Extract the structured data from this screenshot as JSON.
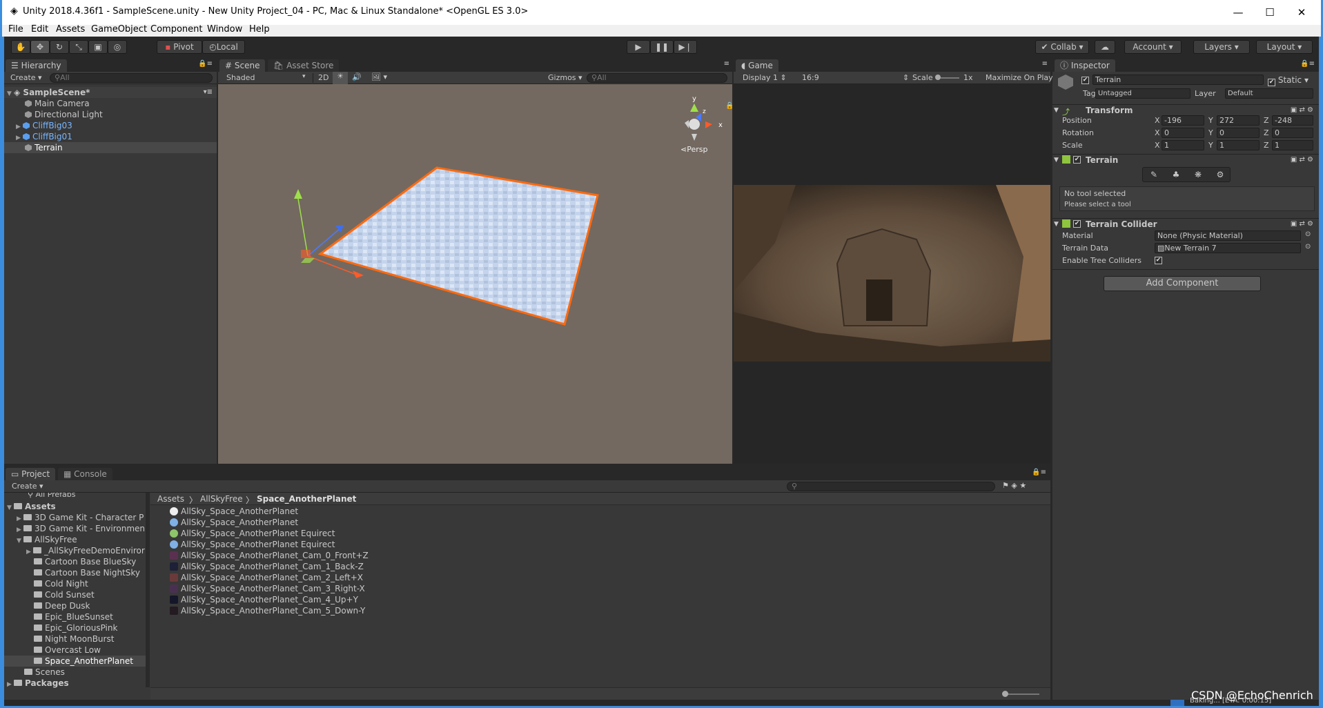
{
  "window": {
    "title": "Unity 2018.4.36f1 - SampleScene.unity - New Unity Project_04 - PC, Mac & Linux Standalone* <OpenGL ES 3.0>",
    "min": "—",
    "max": "☐",
    "close": "✕"
  },
  "menu": [
    "File",
    "Edit",
    "Assets",
    "GameObject",
    "Component",
    "Window",
    "Help"
  ],
  "toolbar": {
    "pivot": "Pivot",
    "local": "Local",
    "collab": "Collab",
    "account": "Account",
    "layers": "Layers",
    "layout": "Layout"
  },
  "hierarchy": {
    "tab": "Hierarchy",
    "create": "Create",
    "search": "All",
    "scene": "SampleScene*",
    "items": [
      {
        "label": "Main Camera"
      },
      {
        "label": "Directional Light"
      },
      {
        "label": "CliffBig03"
      },
      {
        "label": "CliffBig01"
      },
      {
        "label": "Terrain"
      }
    ]
  },
  "scene": {
    "tab": "Scene",
    "asset_store": "Asset Store",
    "shading": "Shaded",
    "mode2d": "2D",
    "gizmos": "Gizmos",
    "search": "All",
    "persp": "Persp",
    "axis_y": "y",
    "axis_x": "x",
    "axis_z": "z"
  },
  "game": {
    "tab": "Game",
    "display": "Display 1",
    "aspect": "16:9",
    "scale_label": "Scale",
    "scale_value": "1x",
    "maximize": "Maximize On Play"
  },
  "inspector": {
    "tab": "Inspector",
    "object_name": "Terrain",
    "static_label": "Static",
    "tag_label": "Tag",
    "tag_value": "Untagged",
    "layer_label": "Layer",
    "layer_value": "Default",
    "transform": {
      "title": "Transform",
      "position": {
        "label": "Position",
        "x": "-196",
        "y": "272",
        "z": "-248"
      },
      "rotation": {
        "label": "Rotation",
        "x": "0",
        "y": "0",
        "z": "0"
      },
      "scale": {
        "label": "Scale",
        "x": "1",
        "y": "1",
        "z": "1"
      },
      "x": "X",
      "y": "Y",
      "z": "Z"
    },
    "terrain": {
      "title": "Terrain",
      "no_tool": "No tool selected",
      "hint": "Please select a tool"
    },
    "collider": {
      "title": "Terrain Collider",
      "material_label": "Material",
      "material_value": "None (Physic Material)",
      "data_label": "Terrain Data",
      "data_value": "New Terrain 7",
      "trees_label": "Enable Tree Colliders"
    },
    "add_component": "Add Component"
  },
  "project": {
    "tab": "Project",
    "console": "Console",
    "create": "Create",
    "tree": [
      {
        "label": "All Prefabs"
      },
      {
        "label": "Assets"
      },
      {
        "label": "3D Game Kit - Character P"
      },
      {
        "label": "3D Game Kit - Environmen"
      },
      {
        "label": "AllSkyFree"
      },
      {
        "label": "_AllSkyFreeDemoEnviror"
      },
      {
        "label": "Cartoon Base BlueSky"
      },
      {
        "label": "Cartoon Base NightSky"
      },
      {
        "label": "Cold Night"
      },
      {
        "label": "Cold Sunset"
      },
      {
        "label": "Deep Dusk"
      },
      {
        "label": "Epic_BlueSunset"
      },
      {
        "label": "Epic_GloriousPink"
      },
      {
        "label": "Night MoonBurst"
      },
      {
        "label": "Overcast Low"
      },
      {
        "label": "Space_AnotherPlanet"
      },
      {
        "label": "Scenes"
      },
      {
        "label": "Packages"
      }
    ],
    "breadcrumb": [
      "Assets",
      "AllSkyFree",
      "Space_AnotherPlanet"
    ],
    "files": [
      "AllSky_Space_AnotherPlanet",
      "AllSky_Space_AnotherPlanet",
      "AllSky_Space_AnotherPlanet Equirect",
      "AllSky_Space_AnotherPlanet Equirect",
      "AllSky_Space_AnotherPlanet_Cam_0_Front+Z",
      "AllSky_Space_AnotherPlanet_Cam_1_Back-Z",
      "AllSky_Space_AnotherPlanet_Cam_2_Left+X",
      "AllSky_Space_AnotherPlanet_Cam_3_Right-X",
      "AllSky_Space_AnotherPlanet_Cam_4_Up+Y",
      "AllSky_Space_AnotherPlanet_Cam_5_Down-Y"
    ]
  },
  "status": {
    "baking": "Baking... [ETA: 0:00:15]",
    "watermark": "CSDN @EchoChenrich"
  },
  "colors": {
    "selection_orange": "#ff6a10",
    "accent_blue": "#3a8ddf",
    "link_blue": "#7ab6ff"
  }
}
